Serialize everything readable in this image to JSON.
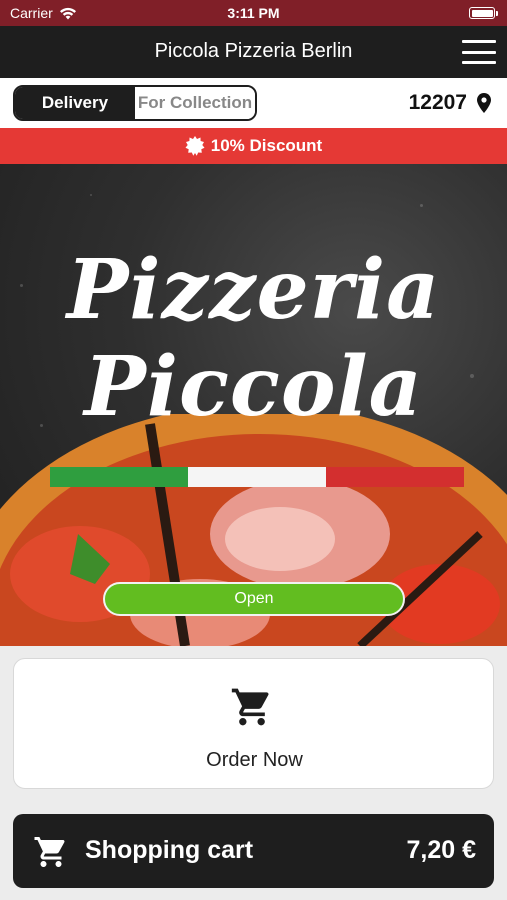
{
  "status_bar": {
    "carrier": "Carrier",
    "time": "3:11 PM"
  },
  "nav": {
    "title": "Piccola Pizzeria Berlin",
    "menu_icon": "hamburger-menu-icon"
  },
  "order_mode": {
    "options": [
      "Delivery",
      "For Collection"
    ],
    "selected": "Delivery"
  },
  "location": {
    "postcode": "12207",
    "icon": "location-pin-icon"
  },
  "discount_banner": {
    "text": "10% Discount",
    "icon": "discount-badge-icon"
  },
  "hero": {
    "logo_line1": "Pizzeria",
    "logo_line2": "Piccola",
    "status_label": "Open"
  },
  "order_card": {
    "label": "Order Now",
    "icon": "cart-icon"
  },
  "cart_bar": {
    "label": "Shopping cart",
    "total": "7,20 €",
    "icon": "cart-icon"
  },
  "colors": {
    "discount_red": "#e53935",
    "open_green": "#62bd20",
    "dark": "#1e1e1e",
    "status_bar": "#801f28"
  }
}
